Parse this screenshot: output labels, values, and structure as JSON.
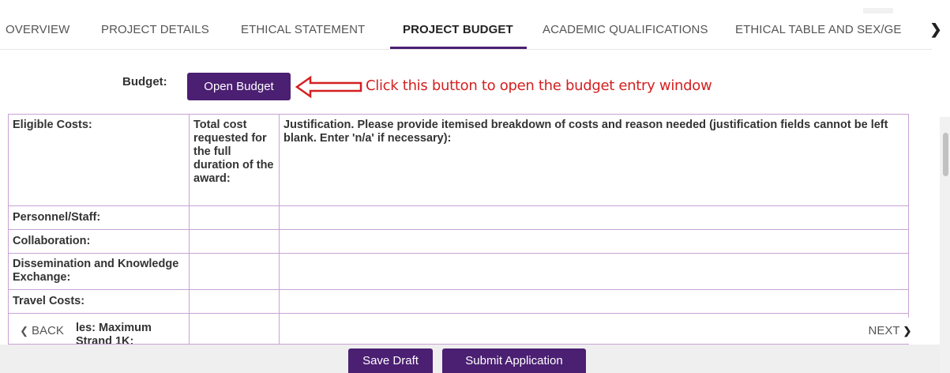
{
  "tabs": [
    {
      "label": "OVERVIEW"
    },
    {
      "label": "PROJECT DETAILS"
    },
    {
      "label": "ETHICAL STATEMENT"
    },
    {
      "label": "PROJECT BUDGET",
      "active": true
    },
    {
      "label": "ACADEMIC QUALIFICATIONS"
    },
    {
      "label": "ETHICAL TABLE AND SEX/GE"
    }
  ],
  "tab_scroll_right_icon": "chevron-right-icon",
  "budget": {
    "label": "Budget:",
    "button_label": "Open Budget"
  },
  "annotation": {
    "text": "Click this button to open the budget entry window",
    "color": "#d42020",
    "icon": "arrow-left-icon"
  },
  "table": {
    "headers": [
      "Eligible Costs:",
      "Total cost requested for the full duration of the award:",
      "Justification. Please provide itemised breakdown of costs and reason needed (justification fields cannot be left blank. Enter 'n/a' if necessary):"
    ],
    "rows": [
      {
        "label": "Personnel/Staff:",
        "total": "",
        "justification": ""
      },
      {
        "label": "Collaboration:",
        "total": "",
        "justification": ""
      },
      {
        "label": "Dissemination and Knowledge Exchange:",
        "total": "",
        "justification": ""
      },
      {
        "label": "Travel Costs:",
        "total": "",
        "justification": ""
      }
    ],
    "partial_row_label": "les: Maximum Strand 1K:"
  },
  "nav": {
    "back_label": "BACK",
    "next_label": "NEXT"
  },
  "footer": {
    "save_draft_label": "Save Draft",
    "submit_label": "Submit Application"
  },
  "colors": {
    "accent": "#4b1f72",
    "table_border": "#c9a2d6"
  }
}
